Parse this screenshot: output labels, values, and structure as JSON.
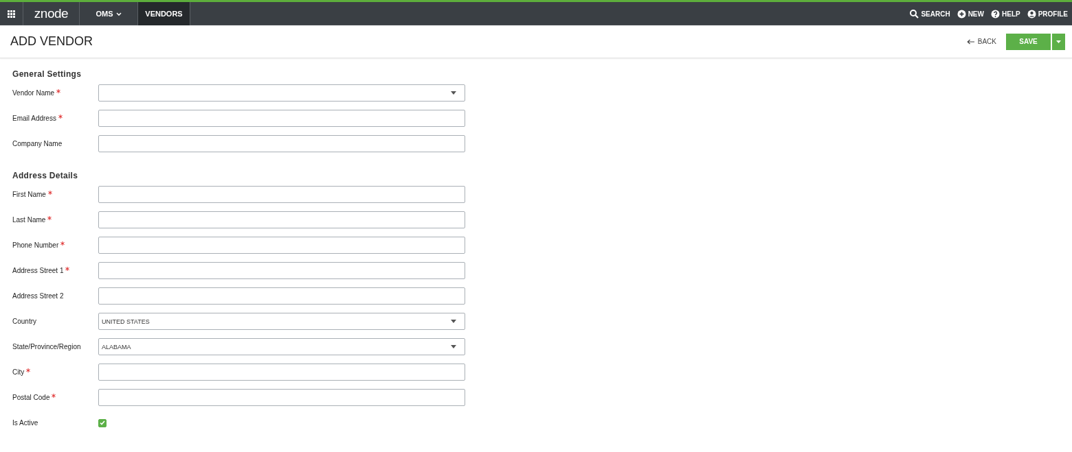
{
  "nav": {
    "logo": "znode",
    "items": [
      {
        "label": "OMS",
        "selected": false,
        "dropdown": true
      },
      {
        "label": "VENDORS",
        "selected": true,
        "dropdown": false
      }
    ],
    "actions": [
      {
        "label": "SEARCH",
        "kind": "search"
      },
      {
        "label": "NEW",
        "kind": "new"
      },
      {
        "label": "HELP",
        "kind": "help"
      },
      {
        "label": "PROFILE",
        "kind": "profile"
      }
    ]
  },
  "header": {
    "title": "ADD VENDOR",
    "back": "BACK",
    "save": "SAVE"
  },
  "sections": [
    {
      "title": "General Settings",
      "fields": [
        {
          "label": "Vendor Name",
          "required": true,
          "kind": "select"
        },
        {
          "label": "Email Address",
          "required": true,
          "kind": "text"
        },
        {
          "label": "Company Name",
          "required": false,
          "kind": "text"
        }
      ]
    },
    {
      "title": "Address Details",
      "fields": [
        {
          "label": "First Name",
          "required": true,
          "kind": "text"
        },
        {
          "label": "Last Name",
          "required": true,
          "kind": "text"
        },
        {
          "label": "Phone Number",
          "required": true,
          "kind": "text"
        },
        {
          "label": "Address Street 1",
          "required": true,
          "kind": "text"
        },
        {
          "label": "Address Street 2",
          "required": false,
          "kind": "text"
        },
        {
          "label": "Country",
          "required": false,
          "kind": "select",
          "value": "UNITED STATES"
        },
        {
          "label": "State/Province/Region",
          "required": false,
          "kind": "select",
          "value": "ALABAMA"
        },
        {
          "label": "City",
          "required": true,
          "kind": "text"
        },
        {
          "label": "Postal Code",
          "required": true,
          "kind": "text"
        },
        {
          "label": "Is Active",
          "required": false,
          "kind": "checkbox",
          "checked": true
        }
      ]
    }
  ]
}
